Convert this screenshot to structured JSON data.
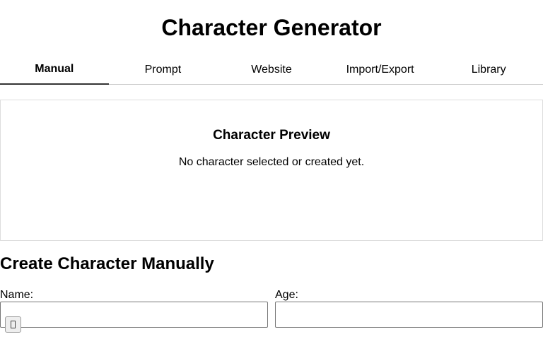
{
  "app": {
    "title": "Character Generator"
  },
  "tabs": [
    {
      "label": "Manual",
      "active": true
    },
    {
      "label": "Prompt",
      "active": false
    },
    {
      "label": "Website",
      "active": false
    },
    {
      "label": "Import/Export",
      "active": false
    },
    {
      "label": "Library",
      "active": false
    }
  ],
  "preview": {
    "title": "Character Preview",
    "empty_message": "No character selected or created yet."
  },
  "manual_form": {
    "title": "Create Character Manually",
    "name_label": "Name:",
    "name_value": "",
    "age_label": "Age:",
    "age_value": ""
  },
  "colors": {
    "active_tab_underline": "#333333",
    "divider": "#cccccc",
    "input_border": "#767676"
  },
  "icons": {
    "overlay_button": "missing-glyph-icon"
  }
}
